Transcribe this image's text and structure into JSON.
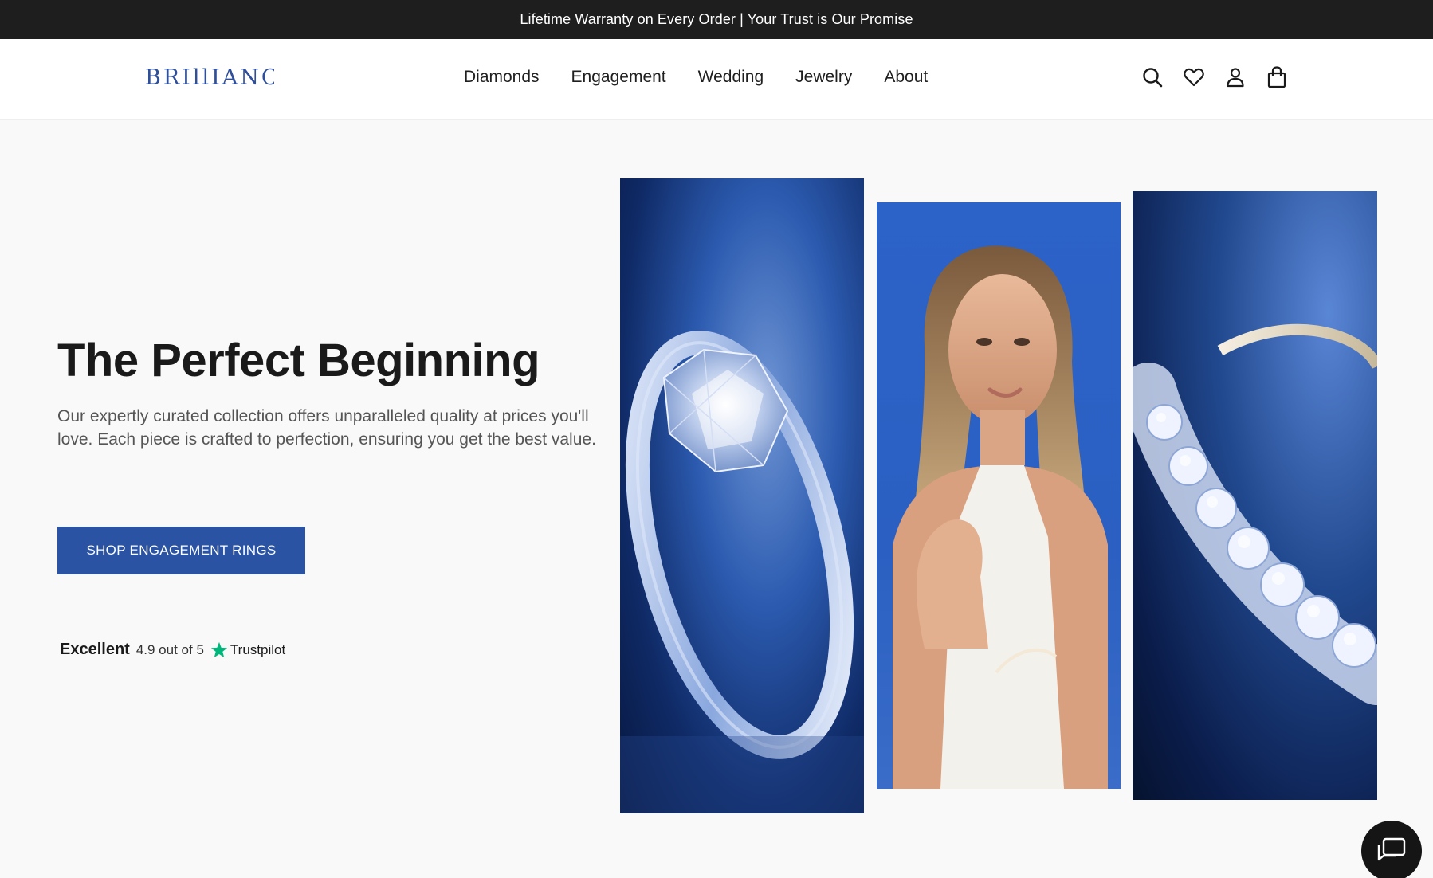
{
  "announcement": "Lifetime Warranty on Every Order | Your Trust is Our Promise",
  "header": {
    "logo": "BRILLIANCE",
    "nav": [
      "Diamonds",
      "Engagement",
      "Wedding",
      "Jewelry",
      "About"
    ],
    "icons": [
      "search-icon",
      "heart-icon",
      "user-icon",
      "bag-icon"
    ]
  },
  "hero": {
    "title": "The Perfect Beginning",
    "text": "Our expertly curated collection offers unparalleled quality at prices you'll love. Each piece is crafted to perfection, ensuring you get the best value.",
    "cta": "SHOP ENGAGEMENT RINGS",
    "rating": {
      "label": "Excellent",
      "score": "4.9 out of 5",
      "brand": "Trustpilot"
    }
  },
  "colors": {
    "accent": "#2a54a3",
    "announce_bg": "#1e1e1e",
    "trustpilot_star": "#00b67a"
  }
}
